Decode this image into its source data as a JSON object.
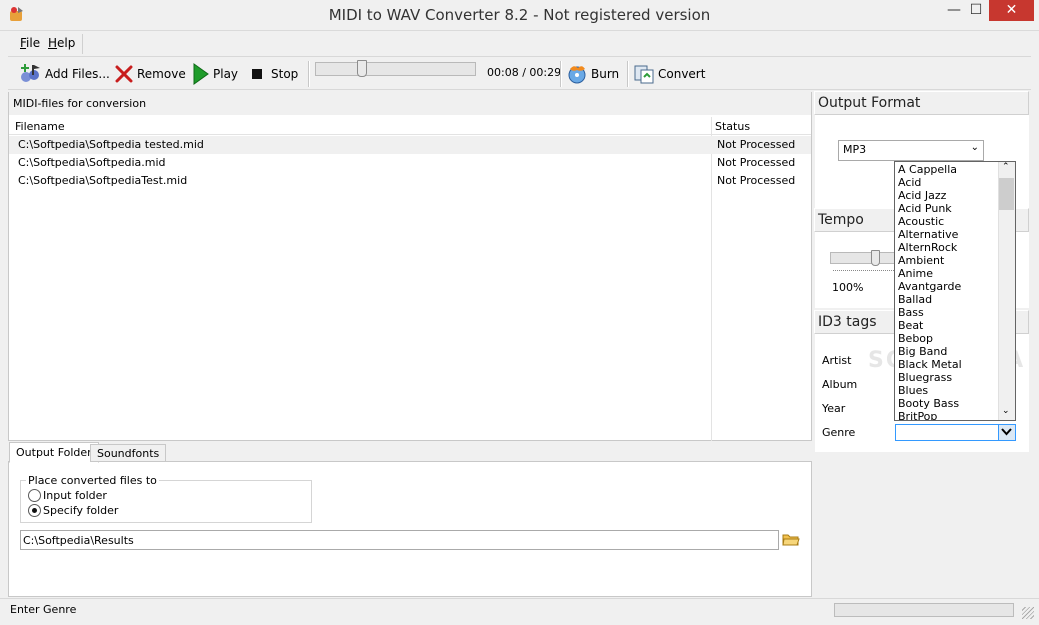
{
  "window": {
    "title": "MIDI to WAV Converter 8.2 - Not registered version",
    "minimize_glyph": "—",
    "maximize_glyph": "☐",
    "close_glyph": "✕"
  },
  "menu": {
    "file_key": "F",
    "file_rest": "ile",
    "help_key": "H",
    "help_rest": "elp"
  },
  "toolbar": {
    "add_files_label": "Add Files...",
    "remove_label": "Remove",
    "play_label": "Play",
    "stop_label": "Stop",
    "time_display": "00:08 / 00:29",
    "burn_label": "Burn",
    "convert_label": "Convert",
    "seek_progress": 0.28
  },
  "files": {
    "panel_title": "MIDI-files for conversion",
    "columns": [
      "Filename",
      "Status"
    ],
    "rows": [
      {
        "filename": "C:\\Softpedia\\Softpedia tested.mid",
        "status": "Not Processed"
      },
      {
        "filename": "C:\\Softpedia\\Softpedia.mid",
        "status": "Not Processed"
      },
      {
        "filename": "C:\\Softpedia\\SoftpediaTest.mid",
        "status": "Not Processed"
      }
    ]
  },
  "bottom_tabs": {
    "tab_output": "Output Folder",
    "tab_soundfonts": "Soundfonts",
    "group_title": "Place converted files to",
    "radio_input": "Input folder",
    "radio_specify": "Specify folder",
    "selected": "Specify folder",
    "path_value": "C:\\Softpedia\\Results"
  },
  "status_bar": {
    "text": "Enter Genre"
  },
  "output_format": {
    "header": "Output Format",
    "selected": "MP3"
  },
  "tempo": {
    "header": "Tempo",
    "value_text": "100%"
  },
  "id3": {
    "header": "ID3 tags",
    "artist_label": "Artist",
    "album_label": "Album",
    "year_label": "Year",
    "genre_label": "Genre",
    "genre_options": [
      "A Cappella",
      "Acid",
      "Acid Jazz",
      "Acid Punk",
      "Acoustic",
      "Alternative",
      "AlternRock",
      "Ambient",
      "Anime",
      "Avantgarde",
      "Ballad",
      "Bass",
      "Beat",
      "Bebop",
      "Big Band",
      "Black Metal",
      "Bluegrass",
      "Blues",
      "Booty Bass",
      "BritPop"
    ]
  },
  "watermark": "SOFTPEDIA",
  "colors": {
    "accent": "#3399ff",
    "play_green": "#1e9c2a",
    "remove_red": "#c81e1e"
  }
}
